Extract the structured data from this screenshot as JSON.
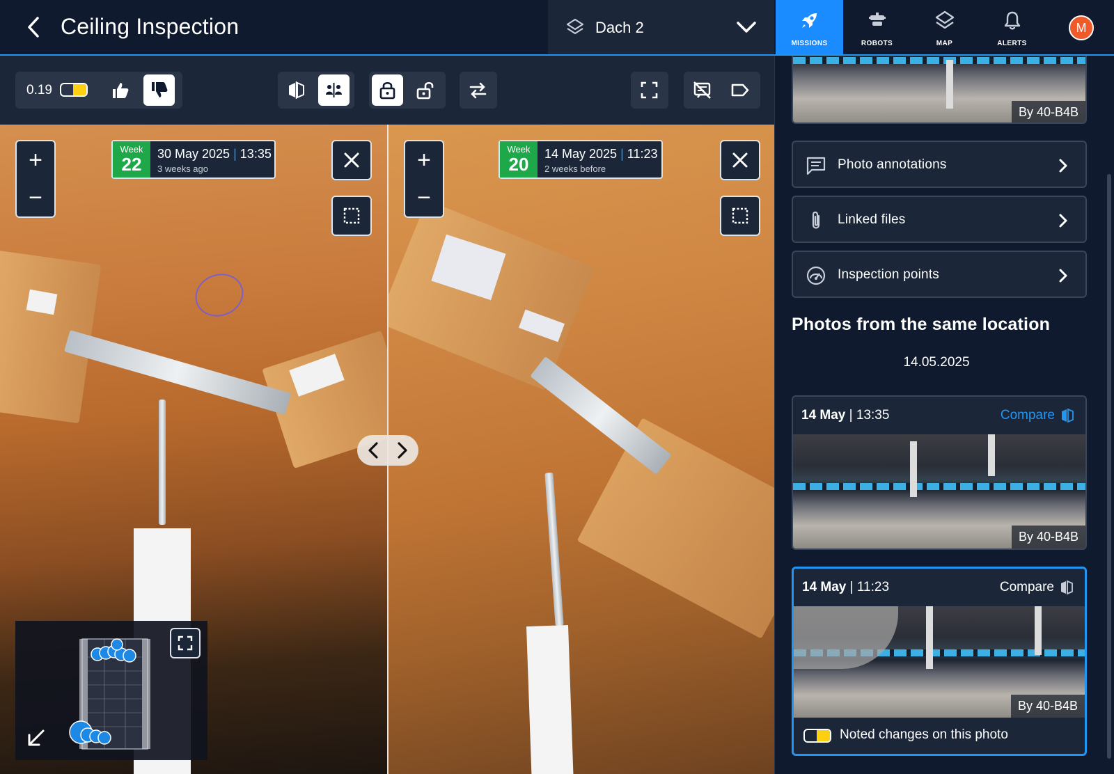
{
  "header": {
    "title": "Ceiling Inspection",
    "floor": "Dach 2",
    "nav": [
      {
        "label": "MISSIONS",
        "icon": "rocket-icon",
        "active": true
      },
      {
        "label": "ROBOTS",
        "icon": "robot-icon",
        "active": false
      },
      {
        "label": "MAP",
        "icon": "layers-icon",
        "active": false
      },
      {
        "label": "ALERTS",
        "icon": "bell-icon",
        "active": false
      }
    ],
    "avatar": "M"
  },
  "toolbar": {
    "score": "0.19",
    "noted_toggle_on": true
  },
  "viewer": {
    "left": {
      "week_label": "Week",
      "week": "22",
      "date": "30 May 2025",
      "time": "13:35",
      "relative": "3 weeks ago"
    },
    "right": {
      "week_label": "Week",
      "week": "20",
      "date": "14 May 2025",
      "time": "11:23",
      "relative": "2 weeks before"
    },
    "zoom_in": "+",
    "zoom_out": "−"
  },
  "sidebar": {
    "top_thumb_by": "By 40-B4B",
    "menu": [
      {
        "label": "Photo annotations",
        "icon": "comment-icon"
      },
      {
        "label": "Linked files",
        "icon": "paperclip-icon"
      },
      {
        "label": "Inspection points",
        "icon": "gauge-icon"
      }
    ],
    "section_title": "Photos from the same location",
    "date_group": "14.05.2025",
    "cards": [
      {
        "day": "14 May",
        "time": "13:35",
        "compare": "Compare",
        "by": "By 40-B4B",
        "selected": false
      },
      {
        "day": "14 May",
        "time": "11:23",
        "compare": "Compare",
        "by": "By 40-B4B",
        "selected": true,
        "noted": "Noted changes on this photo"
      }
    ]
  },
  "colors": {
    "accent": "#2196f3",
    "week_badge": "#1ea84a",
    "toggle": "#ffd012",
    "avatar": "#ef5a2b",
    "panel": "#1b2639"
  }
}
